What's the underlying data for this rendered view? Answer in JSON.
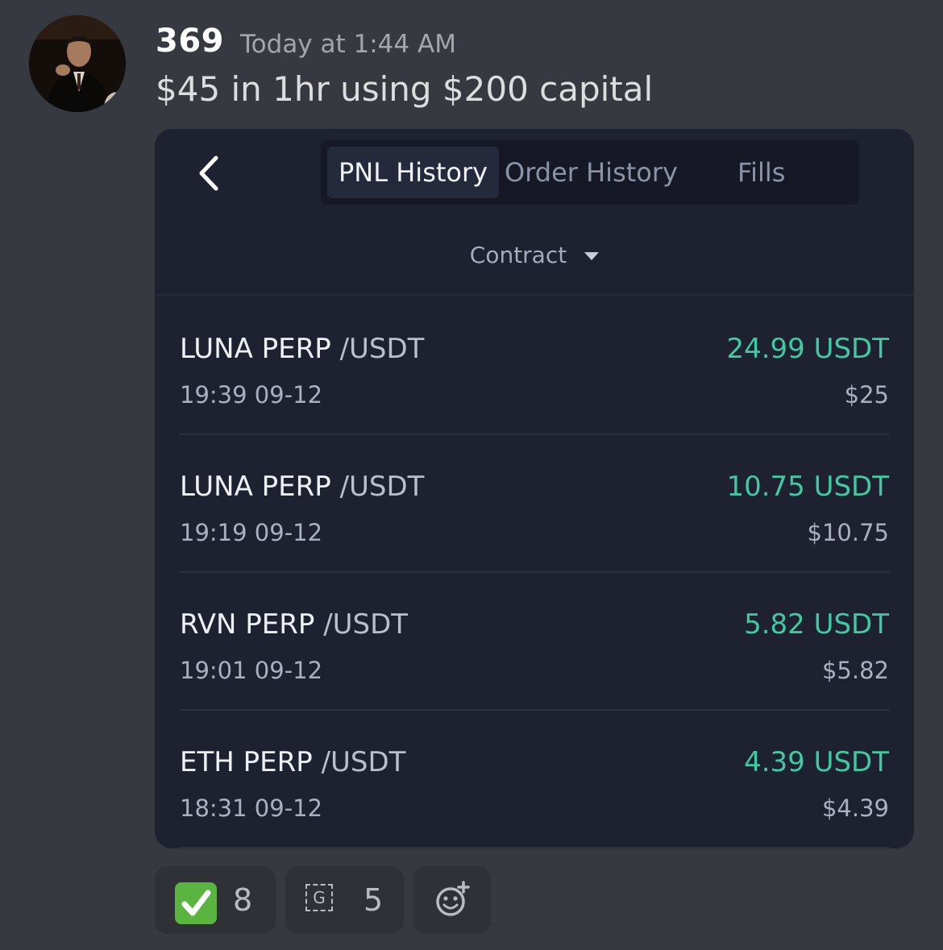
{
  "message": {
    "author": "369",
    "timestamp": "Today at 1:44 AM",
    "content": "$45 in 1hr using $200 capital"
  },
  "screenshot": {
    "tabs": [
      {
        "label": "PNL History",
        "active": true
      },
      {
        "label": "Order History",
        "active": false
      },
      {
        "label": "Fills",
        "active": false
      }
    ],
    "filter": {
      "label": "Contract"
    },
    "rows": [
      {
        "pair": "LUNA PERP",
        "quote": "/USDT",
        "time": "19:39 09-12",
        "pnl": "24.99 USDT",
        "usd": "$25"
      },
      {
        "pair": "LUNA PERP",
        "quote": "/USDT",
        "time": "19:19 09-12",
        "pnl": "10.75 USDT",
        "usd": "$10.75"
      },
      {
        "pair": "RVN PERP",
        "quote": "/USDT",
        "time": "19:01 09-12",
        "pnl": "5.82 USDT",
        "usd": "$5.82"
      },
      {
        "pair": "ETH PERP",
        "quote": "/USDT",
        "time": "18:31 09-12",
        "pnl": "4.39 USDT",
        "usd": "$4.39"
      }
    ],
    "profit_color": "#40c9a2"
  },
  "reactions": [
    {
      "icon": "white-check-mark-icon",
      "count": "8"
    },
    {
      "icon": "g-letter-emoji-icon",
      "count": "5"
    }
  ],
  "add_reaction": {
    "icon": "add-reaction-icon"
  },
  "colors": {
    "background": "#36393f",
    "card": "#1d2130",
    "accent_green": "#40c9a2",
    "check_green": "#59b540"
  }
}
